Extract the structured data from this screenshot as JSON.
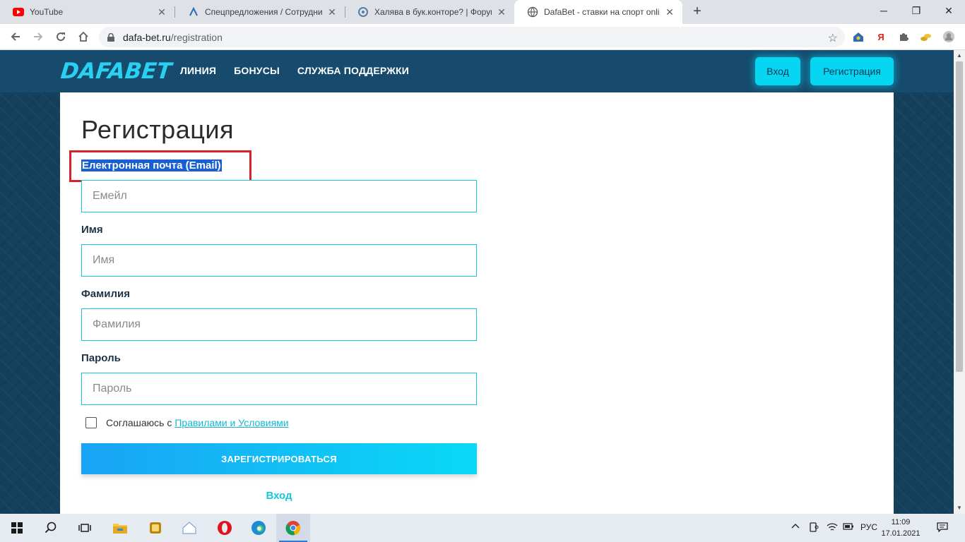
{
  "browser": {
    "tabs": [
      {
        "title": "YouTube",
        "icon": "youtube-icon"
      },
      {
        "title": "Спецпредложения / Сотрудник",
        "icon": "site-icon"
      },
      {
        "title": "Халява в бук.конторе? | Форум",
        "icon": "forum-icon"
      },
      {
        "title": "DafaBet - ставки на спорт online",
        "icon": "globe-icon",
        "active": true
      }
    ],
    "url_host": "dafa-bet.ru",
    "url_path": "/registration"
  },
  "site": {
    "logo": "DAFABET",
    "nav": [
      "ЛИНИЯ",
      "БОНУСЫ",
      "СЛУЖБА ПОДДЕРЖКИ"
    ],
    "login_button": "Вход",
    "register_button": "Регистрация"
  },
  "form": {
    "title": "Регистрация",
    "email_label": "Електронная почта (Email)",
    "email_placeholder": "Емейл",
    "name_label": "Имя",
    "name_placeholder": "Имя",
    "surname_label": "Фамилия",
    "surname_placeholder": "Фамилия",
    "password_label": "Пароль",
    "password_placeholder": "Пароль",
    "agree_text": "Соглашаюсь с",
    "agree_link": "Правилами и Условиями",
    "submit": "ЗАРЕГИСТРИРОВАТЬСЯ",
    "login_link": "Вход"
  },
  "taskbar": {
    "lang": "РУС",
    "time": "11:09",
    "date": "17.01.2021"
  },
  "colors": {
    "accent": "#06d6f2",
    "header": "#164b6d",
    "highlight_box": "#d6232a"
  }
}
